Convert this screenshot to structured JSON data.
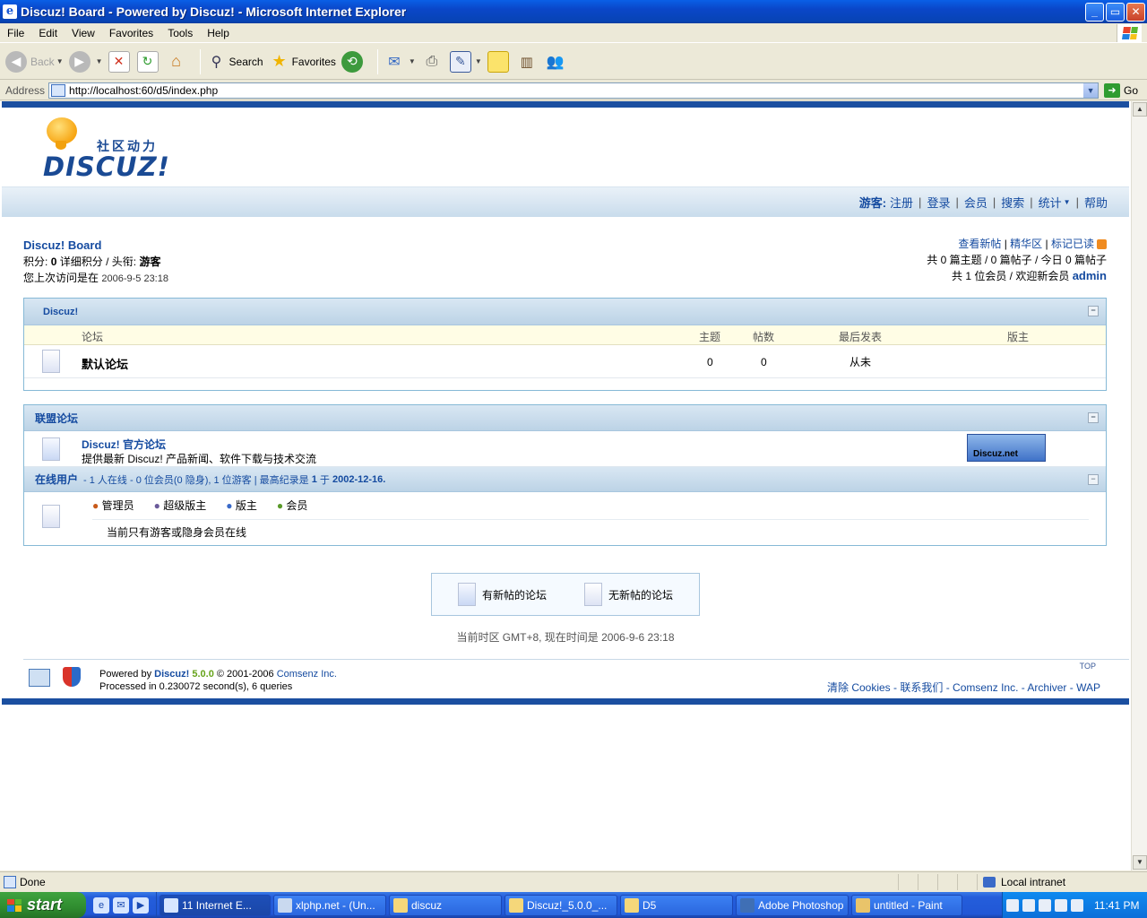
{
  "window": {
    "title": "Discuz! Board - Powered by Discuz! - Microsoft Internet Explorer",
    "controls": [
      "_",
      "▭",
      "✕"
    ]
  },
  "menu": [
    "File",
    "Edit",
    "View",
    "Favorites",
    "Tools",
    "Help"
  ],
  "toolbar": {
    "back": "Back",
    "search": "Search",
    "favorites": "Favorites"
  },
  "address": {
    "label": "Address",
    "url": "http://localhost:60/d5/index.php",
    "go": "Go"
  },
  "site": {
    "logo_cn": "社区动力",
    "logo_en": "DISCUZ!",
    "nav": {
      "guest": "游客:",
      "items": [
        "注册",
        "登录",
        "会员",
        "搜索",
        "统计",
        "帮助"
      ]
    },
    "info_left": {
      "board": "Discuz! Board",
      "points_label": "积分:",
      "points_value": "0",
      "points_detail": "详细积分",
      "title_label": "/ 头衔:",
      "title_value": "游客",
      "last_visit_label": "您上次访问是在",
      "last_visit_value": "2006-9-5 23:18"
    },
    "info_right": {
      "links": [
        "查看新帖",
        "精华区",
        "标记已读"
      ],
      "stats_line": "共 0 篇主题 / 0 篇帖子 / 今日 0 篇帖子",
      "members_line": "共 1 位会员 / 欢迎新会员",
      "new_member": "admin"
    },
    "forum_category": {
      "title": "Discuz!",
      "columns": [
        "论坛",
        "主题",
        "帖数",
        "最后发表",
        "版主"
      ],
      "rows": [
        {
          "name": "默认论坛",
          "topics": "0",
          "posts": "0",
          "last_post": "从未",
          "moderator": ""
        }
      ]
    },
    "league": {
      "title": "联盟论坛",
      "name": "Discuz! 官方论坛",
      "desc": "提供最新 Discuz! 产品新闻、软件下载与技术交流",
      "banner": "Discuz.net"
    },
    "online": {
      "title": "在线用户",
      "summary_1": "- 1 人在线",
      "summary_2": "- 0 位会员(0 隐身), 1 位游客",
      "summary_3": "| 最高纪录是",
      "record_count": "1",
      "summary_4": "于",
      "record_date": "2002-12-16.",
      "legend": [
        "管理员",
        "超级版主",
        "版主",
        "会员"
      ],
      "current": "当前只有游客或隐身会员在线"
    },
    "legend_box": {
      "new": "有新帖的论坛",
      "nonew": "无新帖的论坛"
    },
    "timezone": "当前时区 GMT+8, 现在时间是 2006-9-6 23:18",
    "footer": {
      "powered": "Powered by",
      "brand": "Discuz!",
      "version": "5.0.0",
      "copyright": "© 2001-2006",
      "company": "Comsenz Inc.",
      "processed": "Processed in 0.230072 second(s), 6 queries",
      "top": "TOP",
      "links": [
        "清除 Cookies",
        "联系我们",
        "Comsenz Inc.",
        "Archiver",
        "WAP"
      ]
    }
  },
  "status": {
    "text": "Done",
    "zone": "Local intranet"
  },
  "taskbar": {
    "start": "start",
    "tasks": [
      "11 Internet E...",
      "xlphp.net - (Un...",
      "discuz",
      "Discuz!_5.0.0_...",
      "D5",
      "Adobe Photoshop",
      "untitled - Paint"
    ],
    "clock": "11:41 PM"
  }
}
